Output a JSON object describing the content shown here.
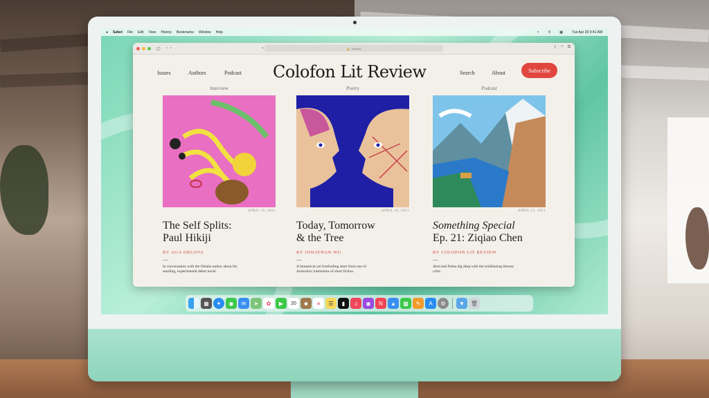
{
  "menubar": {
    "apple": "",
    "items": [
      "Safari",
      "File",
      "Edit",
      "View",
      "History",
      "Bookmarks",
      "Window",
      "Help"
    ],
    "clock": "Tue Apr 20  9:41 AM"
  },
  "browser": {
    "url": "colon.lit"
  },
  "site": {
    "brand": "Colofon Lit Review",
    "nav_left": [
      "Issues",
      "Authors",
      "Podcast"
    ],
    "nav_right": [
      "Search",
      "About"
    ],
    "subscribe_label": "Subscribe"
  },
  "cards": [
    {
      "kicker": "Interview",
      "date": "APRIL 19, 2021",
      "title_line1": "The Self Splits:",
      "title_line2": "Paul Hikiji",
      "byline": "BY AGA ORLOVA",
      "blurb": "In conversation with the Omaha author about his startling, experimental debut novel."
    },
    {
      "kicker": "Poetry",
      "date": "APRIL 16, 2021",
      "title_line1": "Today, Tomorrow",
      "title_line2": "& the Tree",
      "byline": "BY JONATHAN WU",
      "blurb": "A fantastical yet foreboding short from one of Australia's luminaries of short fiction."
    },
    {
      "kicker": "Podcast",
      "date": "APRIL 15, 2021",
      "title_line1": "Something Special",
      "title_line2": "Ep. 21: Ziqiao Chen",
      "byline": "BY COLOFON LIT REVIEW",
      "blurb": "Aled and Nisha dig deep with the trailblazing literary critic."
    }
  ],
  "dock": {
    "calendar_day": "20",
    "apps": [
      "finder-icon",
      "launchpad-icon",
      "safari-icon",
      "messages-icon",
      "mail-icon",
      "maps-icon",
      "photos-icon",
      "facetime-icon",
      "calendar-icon",
      "contacts-icon",
      "reminders-icon",
      "notes-icon",
      "tv-icon",
      "music-icon",
      "podcasts-icon",
      "news-icon",
      "keynote-icon",
      "numbers-icon",
      "pages-icon",
      "app-store-icon",
      "system-preferences-icon",
      "downloads-folder-icon",
      "trash-icon"
    ]
  },
  "colors": {
    "accent": "#e0463e",
    "imac_body": "#9fd8c3"
  }
}
